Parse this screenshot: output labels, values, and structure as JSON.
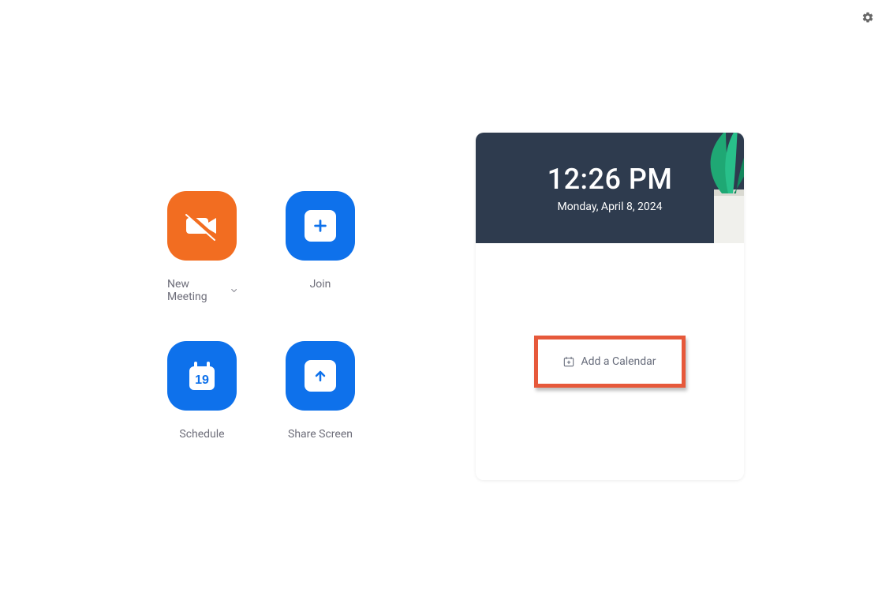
{
  "actions": {
    "new_meeting": {
      "label": "New Meeting"
    },
    "join": {
      "label": "Join"
    },
    "schedule": {
      "label": "Schedule",
      "day_number": "19"
    },
    "share_screen": {
      "label": "Share Screen"
    }
  },
  "clock": {
    "time": "12:26 PM",
    "date": "Monday, April 8, 2024"
  },
  "calendar": {
    "add_label": "Add a Calendar"
  },
  "colors": {
    "orange": "#F26D21",
    "blue": "#0E71EB",
    "header_bg": "#2e3b4e",
    "highlight": "#e6593b"
  }
}
